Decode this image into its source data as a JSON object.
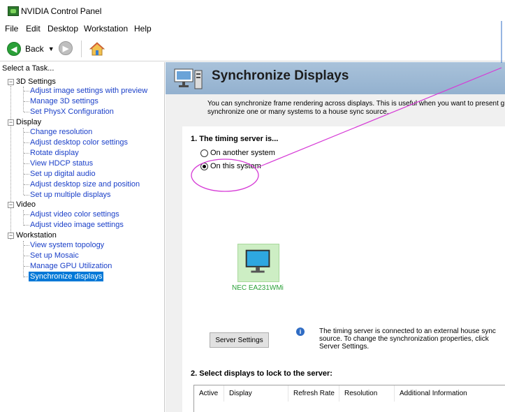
{
  "window": {
    "title": "NVIDIA Control Panel"
  },
  "menu": [
    "File",
    "Edit",
    "Desktop",
    "Workstation",
    "Help"
  ],
  "toolbar": {
    "back_label": "Back"
  },
  "left_panel": {
    "header": "Select a Task...",
    "categories": [
      {
        "label": "3D Settings",
        "items": [
          "Adjust image settings with preview",
          "Manage 3D settings",
          "Set PhysX Configuration"
        ]
      },
      {
        "label": "Display",
        "items": [
          "Change resolution",
          "Adjust desktop color settings",
          "Rotate display",
          "View HDCP status",
          "Set up digital audio",
          "Adjust desktop size and position",
          "Set up multiple displays"
        ]
      },
      {
        "label": "Video",
        "items": [
          "Adjust video color settings",
          "Adjust video image settings"
        ]
      },
      {
        "label": "Workstation",
        "items": [
          "View system topology",
          "Set up Mosaic",
          "Manage GPU Utilization",
          "Synchronize displays"
        ]
      }
    ],
    "selected": "Synchronize displays"
  },
  "main": {
    "title": "Synchronize Displays",
    "description_line1": "You can synchronize frame rendering across displays. This is useful when you want to present gra",
    "description_line2": "synchronize one or many systems to a house sync source.",
    "section1": "1. The timing server is...",
    "radio_other": "On another system",
    "radio_this": "On this system",
    "selected_radio": "this",
    "display_name": "NEC EA231WMi",
    "server_settings_label": "Server Settings",
    "info_line1": "The timing server is connected to an external house sync",
    "info_line2": "source. To change the synchronization properties, click",
    "info_line3": "Server Settings.",
    "section2": "2. Select displays to lock to the server:",
    "table_columns": [
      "Active",
      "Display",
      "Refresh Rate",
      "Resolution",
      "Additional Information"
    ]
  },
  "colors": {
    "accent_selected": "#0078d7",
    "link": "#1a3fc8",
    "annotation": "#d63ad6",
    "banner": "#9bb7d4"
  }
}
